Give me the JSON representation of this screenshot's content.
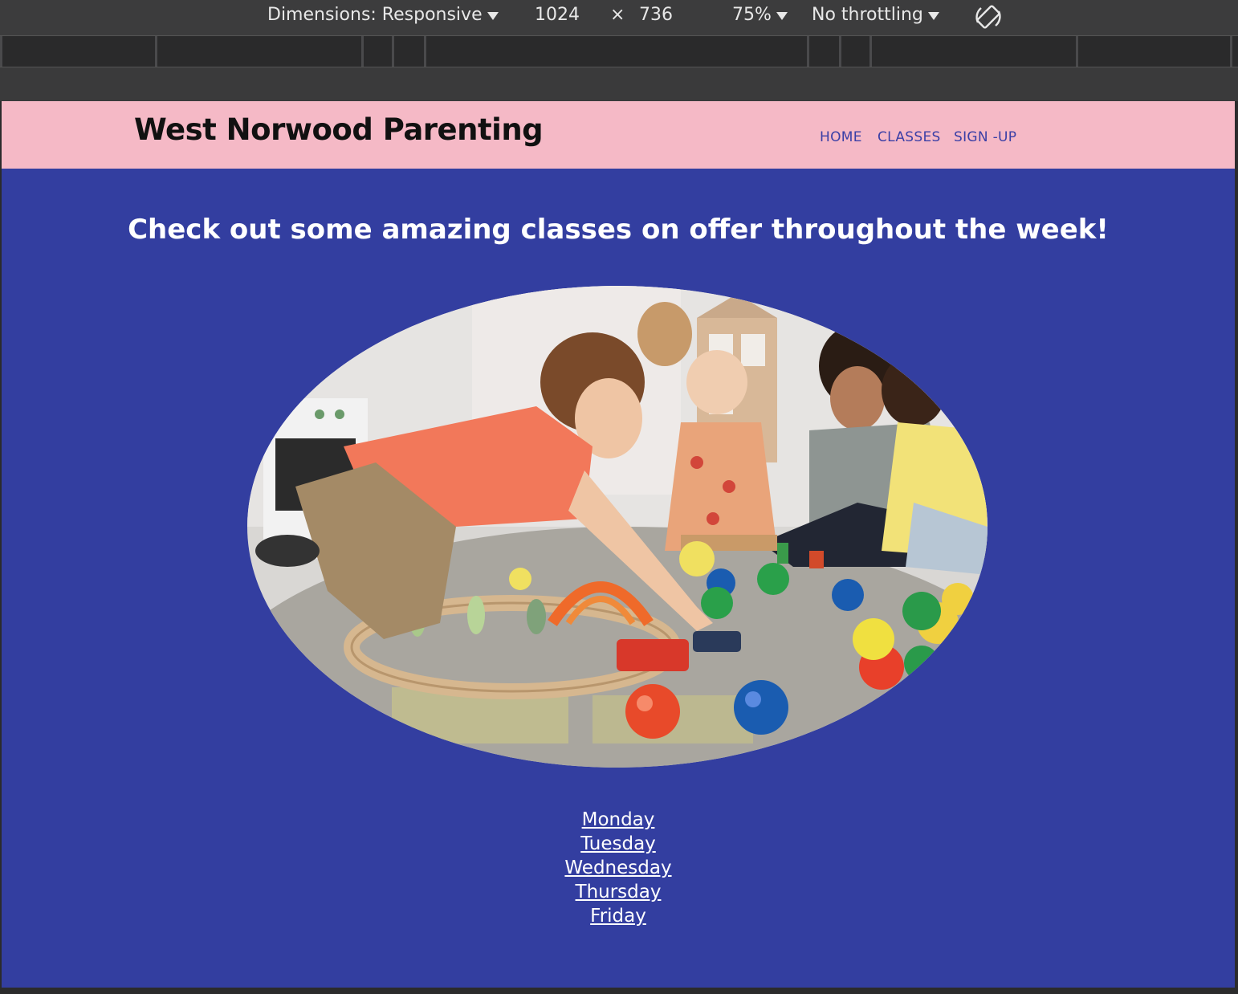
{
  "devtools": {
    "dimensions_label": "Dimensions: Responsive",
    "width": "1024",
    "times": "×",
    "height": "736",
    "zoom": "75%",
    "throttling": "No throttling"
  },
  "site": {
    "brand": "West Norwood Parenting",
    "nav": [
      "HOME",
      "CLASSES",
      "SIGN -UP"
    ],
    "headline": "Check out some amazing classes on offer throughout the week!",
    "days": [
      "Monday",
      "Tuesday",
      "Wednesday",
      "Thursday",
      "Friday"
    ]
  },
  "colors": {
    "header_bg": "#f5b9c6",
    "page_bg": "#333ea0",
    "nav_text": "#3a3fa6"
  }
}
